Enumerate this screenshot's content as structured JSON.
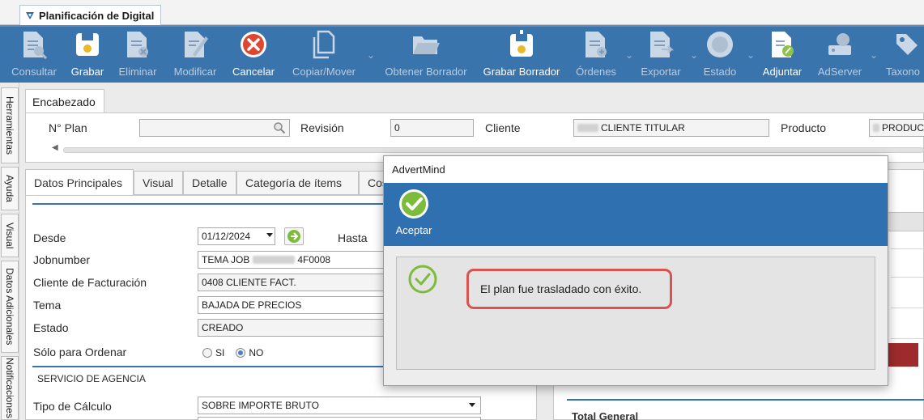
{
  "document_tab": {
    "label": "Planificación de Digital"
  },
  "ribbon": {
    "buttons": [
      {
        "label": "Consultar",
        "icon": "document-search-icon",
        "enabled": false
      },
      {
        "label": "Grabar",
        "icon": "save-disk-icon",
        "enabled": true
      },
      {
        "label": "Eliminar",
        "icon": "document-delete-icon",
        "enabled": false
      },
      {
        "label": "Modificar",
        "icon": "document-edit-icon",
        "enabled": false
      },
      {
        "label": "Cancelar",
        "icon": "cancel-icon",
        "enabled": true
      },
      {
        "label": "Copiar/Mover",
        "icon": "copy-icon",
        "enabled": false
      },
      {
        "label": "Obtener Borrador",
        "icon": "folder-open-icon",
        "enabled": false
      },
      {
        "label": "Grabar Borrador",
        "icon": "save-draft-icon",
        "enabled": true
      },
      {
        "label": "Órdenes",
        "icon": "orders-icon",
        "enabled": false
      },
      {
        "label": "Exportar",
        "icon": "export-icon",
        "enabled": false
      },
      {
        "label": "Estado",
        "icon": "status-icon",
        "enabled": false
      },
      {
        "label": "Adjuntar",
        "icon": "attach-icon",
        "enabled": true
      },
      {
        "label": "AdServer",
        "icon": "adserver-icon",
        "enabled": false
      },
      {
        "label": "Taxono",
        "icon": "tag-icon",
        "enabled": false
      }
    ]
  },
  "side_tabs": [
    "Herramientas",
    "Ayuda",
    "Visual",
    "Datos Adicionales",
    "Notificaciones"
  ],
  "header": {
    "tab_label": "Encabezado",
    "plan_label": "N° Plan",
    "revision_label": "Revisión",
    "revision_value": "0",
    "cliente_label": "Cliente",
    "cliente_value": "CLIENTE TITULAR",
    "producto_label": "Producto",
    "producto_value": "PRODUC"
  },
  "main_tabs": [
    "Datos Principales",
    "Visual",
    "Detalle",
    "Categoría de ítems",
    "Cos"
  ],
  "form": {
    "desde_label": "Desde",
    "desde_value": "01/12/2024",
    "hasta_label": "Hasta",
    "jobnumber_label": "Jobnumber",
    "jobnumber_prefix": "TEMA JOB",
    "jobnumber_suffix": "4F0008",
    "cliente_fact_label": "Cliente de Facturación",
    "cliente_fact_value": "0408 CLIENTE FACT.",
    "tema_label": "Tema",
    "tema_value": "BAJADA DE PRECIOS",
    "estado_label": "Estado",
    "estado_value": "CREADO",
    "solo_ordenar_label": "Sólo para Ordenar",
    "radio_si": "SI",
    "radio_no": "NO",
    "radio_selected": "NO",
    "servicio_section": "SERVICIO DE AGENCIA",
    "tipo_calculo_label": "Tipo de Cálculo",
    "tipo_calculo_value": "SOBRE IMPORTE BRUTO"
  },
  "right_panel": {
    "total_label": "Total General"
  },
  "dialog": {
    "title": "AdvertMind",
    "button_label": "Aceptar",
    "message": "El plan fue trasladado con éxito.",
    "accent": "#2f70b0",
    "highlight": "#d9534f",
    "success": "#7dbb3a"
  }
}
